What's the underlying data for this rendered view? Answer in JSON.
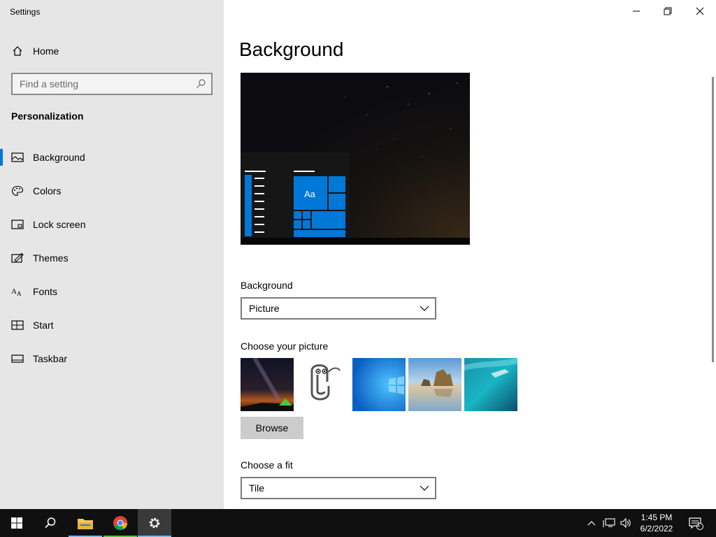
{
  "window": {
    "title": "Settings",
    "controls": {
      "minimize": "minimize-icon",
      "restore": "restore-icon",
      "close": "close-icon"
    }
  },
  "sidebar": {
    "home_label": "Home",
    "search_placeholder": "Find a setting",
    "section_title": "Personalization",
    "items": [
      {
        "label": "Background",
        "icon": "picture-icon",
        "active": true
      },
      {
        "label": "Colors",
        "icon": "palette-icon",
        "active": false
      },
      {
        "label": "Lock screen",
        "icon": "lock-screen-icon",
        "active": false
      },
      {
        "label": "Themes",
        "icon": "themes-icon",
        "active": false
      },
      {
        "label": "Fonts",
        "icon": "fonts-icon",
        "active": false
      },
      {
        "label": "Start",
        "icon": "start-icon",
        "active": false
      },
      {
        "label": "Taskbar",
        "icon": "taskbar-icon",
        "active": false
      }
    ]
  },
  "main": {
    "title": "Background",
    "preview": {
      "tile_text": "Aa"
    },
    "background": {
      "label": "Background",
      "selected": "Picture"
    },
    "choose_picture": {
      "label": "Choose your picture",
      "thumbnails": [
        "night-sky-tent-thumbnail",
        "clippy-thumbnail",
        "windows-blue-thumbnail",
        "beach-rocks-thumbnail",
        "underwater-swimmer-thumbnail"
      ],
      "browse_label": "Browse"
    },
    "fit": {
      "label": "Choose a fit",
      "selected": "Tile"
    }
  },
  "taskbar": {
    "apps": [
      "start-icon",
      "search-icon",
      "file-explorer-icon",
      "chrome-icon",
      "settings-icon"
    ],
    "time": "1:45 PM",
    "date": "6/2/2022",
    "notification_count": "1"
  },
  "colors": {
    "accent": "#0078d7",
    "sidebar_bg": "#e6e6e6",
    "taskbar_bg": "#101010"
  }
}
